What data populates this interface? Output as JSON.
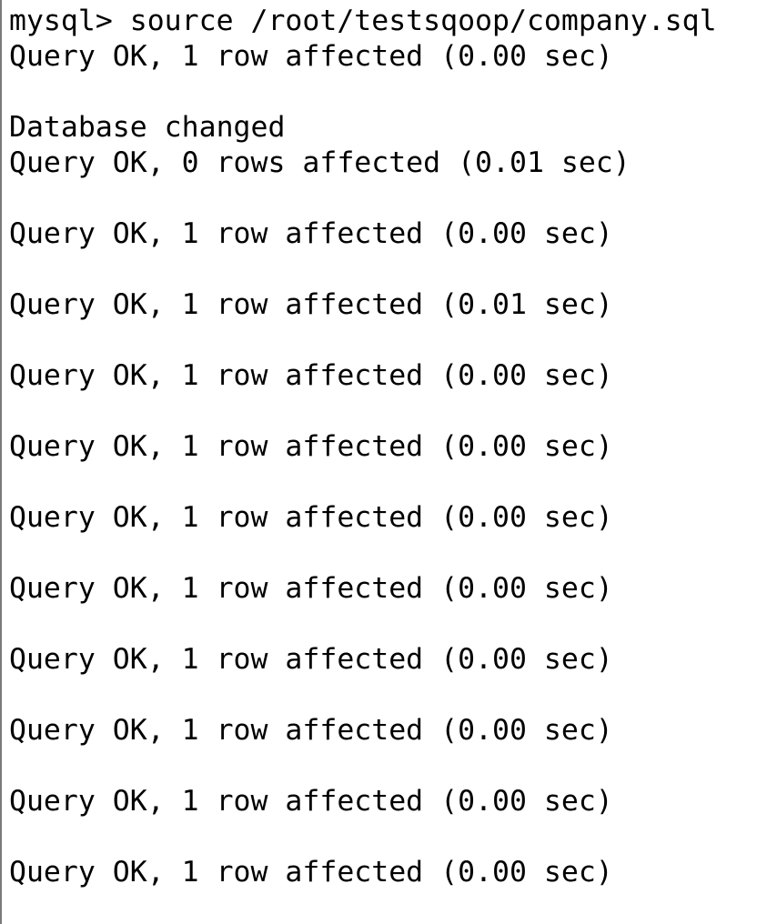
{
  "terminal": {
    "lines": [
      "mysql> source /root/testsqoop/company.sql",
      "Query OK, 1 row affected (0.00 sec)",
      "",
      "Database changed",
      "Query OK, 0 rows affected (0.01 sec)",
      "",
      "Query OK, 1 row affected (0.00 sec)",
      "",
      "Query OK, 1 row affected (0.01 sec)",
      "",
      "Query OK, 1 row affected (0.00 sec)",
      "",
      "Query OK, 1 row affected (0.00 sec)",
      "",
      "Query OK, 1 row affected (0.00 sec)",
      "",
      "Query OK, 1 row affected (0.00 sec)",
      "",
      "Query OK, 1 row affected (0.00 sec)",
      "",
      "Query OK, 1 row affected (0.00 sec)",
      "",
      "Query OK, 1 row affected (0.00 sec)",
      "",
      "Query OK, 1 row affected (0.00 sec)"
    ]
  }
}
